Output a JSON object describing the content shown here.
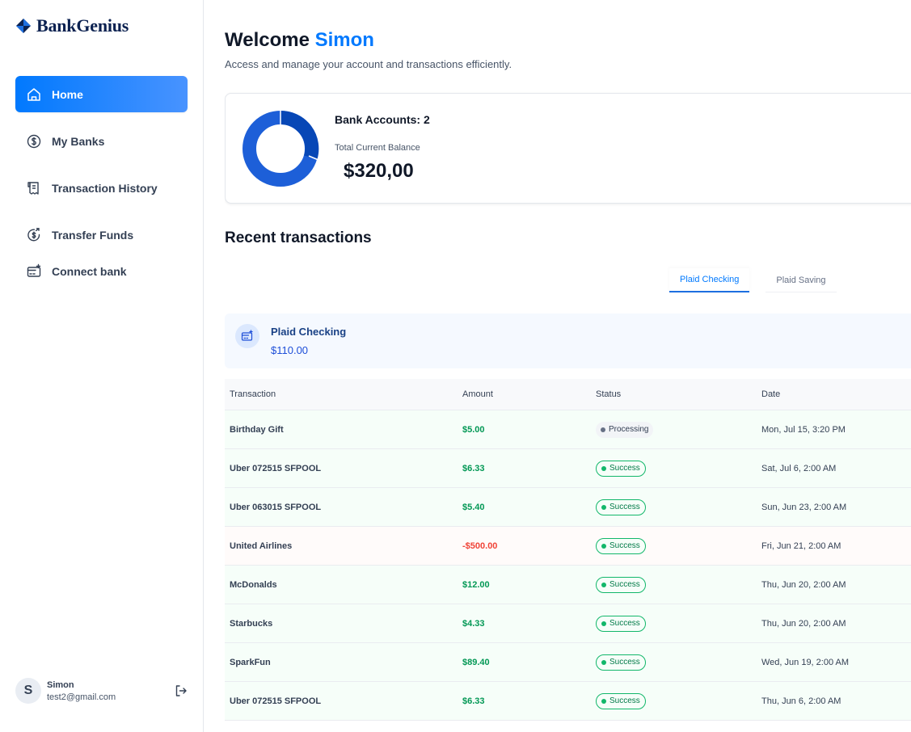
{
  "app": {
    "name": "BankGenius"
  },
  "sidebar": {
    "items": [
      {
        "label": "Home",
        "icon": "home-icon"
      },
      {
        "label": "My Banks",
        "icon": "dollar-circle-icon"
      },
      {
        "label": "Transaction History",
        "icon": "receipt-icon"
      },
      {
        "label": "Transfer Funds",
        "icon": "money-send-icon"
      },
      {
        "label": "Connect bank",
        "icon": "card-add-icon"
      }
    ],
    "active": "Home"
  },
  "user": {
    "initial": "S",
    "name": "Simon",
    "email": "test2@gmail.com"
  },
  "header": {
    "greeting": "Welcome",
    "user_name": "Simon",
    "subtitle": "Access and manage your account and transactions efficiently."
  },
  "balance": {
    "accounts_label": "Bank Accounts: 2",
    "total_label": "Total Current Balance",
    "total_value": "$320,00"
  },
  "recent": {
    "title": "Recent transactions",
    "tabs": [
      "Plaid Checking",
      "Plaid Saving"
    ],
    "active_tab": "Plaid Checking",
    "bank": {
      "name": "Plaid Checking",
      "amount": "$110.00"
    },
    "columns": [
      "Transaction",
      "Amount",
      "Status",
      "Date"
    ],
    "rows": [
      {
        "name": "Birthday Gift",
        "amount": "$5.00",
        "status": "Processing",
        "date": "Mon, Jul 15, 3:20 PM",
        "type": "credit"
      },
      {
        "name": "Uber 072515 SFPOOL",
        "amount": "$6.33",
        "status": "Success",
        "date": "Sat, Jul 6, 2:00 AM",
        "type": "credit"
      },
      {
        "name": "Uber 063015 SFPOOL",
        "amount": "$5.40",
        "status": "Success",
        "date": "Sun, Jun 23, 2:00 AM",
        "type": "credit"
      },
      {
        "name": "United Airlines",
        "amount": "-$500.00",
        "status": "Success",
        "date": "Fri, Jun 21, 2:00 AM",
        "type": "debit"
      },
      {
        "name": "McDonalds",
        "amount": "$12.00",
        "status": "Success",
        "date": "Thu, Jun 20, 2:00 AM",
        "type": "credit"
      },
      {
        "name": "Starbucks",
        "amount": "$4.33",
        "status": "Success",
        "date": "Thu, Jun 20, 2:00 AM",
        "type": "credit"
      },
      {
        "name": "SparkFun",
        "amount": "$89.40",
        "status": "Success",
        "date": "Wed, Jun 19, 2:00 AM",
        "type": "credit"
      },
      {
        "name": "Uber 072515 SFPOOL",
        "amount": "$6.33",
        "status": "Success",
        "date": "Thu, Jun 6, 2:00 AM",
        "type": "credit"
      }
    ]
  },
  "colors": {
    "accent": "#0179fe",
    "donut_primary": "#1d5fd8",
    "donut_secondary": "#0747b6",
    "success": "#12b76a",
    "debit": "#f04438"
  }
}
